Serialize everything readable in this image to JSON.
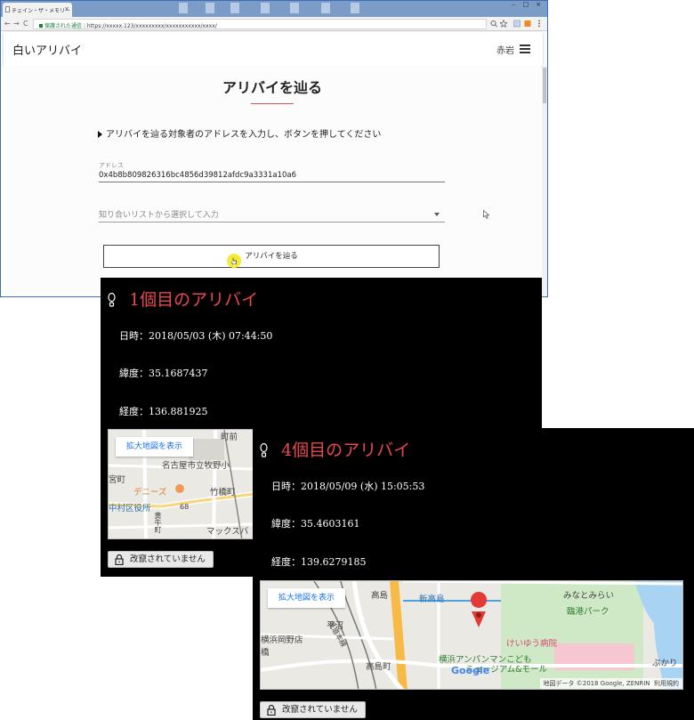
{
  "browser": {
    "tab_title": "チェイン・ザ・メモリー",
    "tab_close": "×",
    "window_controls": [
      "–",
      "□",
      "×"
    ],
    "nav": {
      "back": "←",
      "forward": "→",
      "reload": "C"
    },
    "secure_label": "保護された通信",
    "url": "https://xxxxx.123/xxxxxxxxx/xxxxxxxxxxx/xxxx/"
  },
  "navbar": {
    "brand": "白いアリバイ",
    "user": "赤岩"
  },
  "main": {
    "title": "アリバイを辿る",
    "instruction": "アリバイを辿る対象者のアドレスを入力し、ボタンを押してください",
    "address_label": "アドレス",
    "address_value": "0x4b8b809826316bc4856d39812afdc9a3331a10a6",
    "select_placeholder": "知り合いリストから選択して入力",
    "trace_button": "アリバイを辿る"
  },
  "alibis": [
    {
      "title": "1個目のアリバイ",
      "datetime": "日時：2018/05/03 (木) 07:44:50",
      "latitude": "緯度：35.1687437",
      "longitude": "経度：136.881925",
      "map_link": "拡大地図を表示",
      "map_labels": [
        "町前",
        "名古屋市立牧野小",
        "宮町",
        "デニーズ",
        "竹橋町",
        "中村区役所",
        "68",
        "マックスバ",
        "黄牛町"
      ],
      "tamper_status": "改竄されていません"
    },
    {
      "title": "4個目のアリバイ",
      "datetime": "日時：2018/05/09 (水) 15:05:53",
      "latitude": "緯度：35.4603161",
      "longitude": "経度：139.6279185",
      "map_link": "拡大地図を表示",
      "map_labels": [
        "高島",
        "新高島",
        "みなとみらい",
        "臨港パーク",
        "平沼",
        "横浜岡野店",
        "橋",
        "県道本線",
        "けいゆう病院",
        "横浜アンパンマンこども",
        "ミュージアム&モール",
        "高島町",
        "ぷかり"
      ],
      "google": "Google",
      "copyright": "地図データ ©2018 Google, ZENRIN",
      "terms": "利用規約",
      "tamper_status": "改竄されていません"
    }
  ],
  "colors": {
    "accent": "#e8494f",
    "panel_bg": "#000000",
    "title_underline": "#d9534f"
  }
}
